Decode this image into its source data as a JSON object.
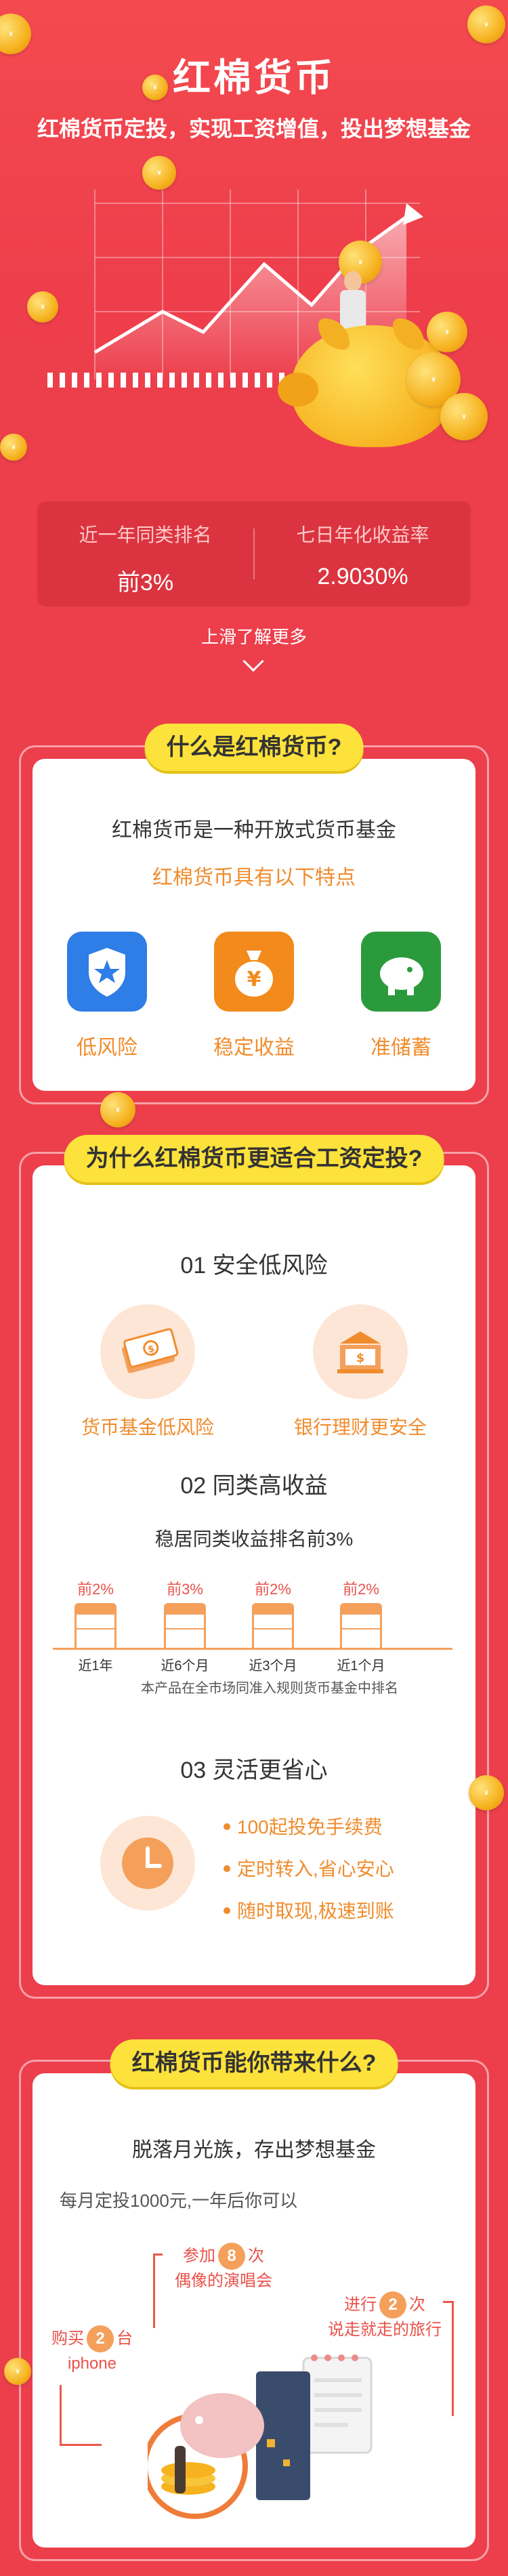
{
  "hero": {
    "title": "红棉货币",
    "subtitle": "红棉货币定投，实现工资增值，投出梦想基金"
  },
  "stats": [
    {
      "label": "近一年同类排名",
      "value": "前3%"
    },
    {
      "label": "七日年化收益率",
      "value": "2.9030%"
    }
  ],
  "more_label": "上滑了解更多",
  "section1": {
    "pill": "什么是红棉货币?",
    "line1": "红棉货币是一种开放式货币基金",
    "line2": "红棉货币具有以下特点",
    "features": [
      {
        "label": "低风险",
        "icon": "shield-star-icon",
        "color": "#2f7de6"
      },
      {
        "label": "稳定收益",
        "icon": "money-bag-icon",
        "color": "#f38a1c"
      },
      {
        "label": "准储蓄",
        "icon": "piggy-bank-icon",
        "color": "#2b9a3c"
      }
    ]
  },
  "section2": {
    "pill": "为什么红棉货币更适合工资定投?",
    "h1": "01 安全低风险",
    "h1_items": [
      "货币基金低风险",
      "银行理财更安全"
    ],
    "h2": "02 同类高收益",
    "h2_sub": "稳居同类收益排名前3%",
    "bars": [
      {
        "rank": "前2%",
        "period": "近1年"
      },
      {
        "rank": "前3%",
        "period": "近6个月"
      },
      {
        "rank": "前2%",
        "period": "近3个月"
      },
      {
        "rank": "前2%",
        "period": "近1个月"
      }
    ],
    "bars_note": "本产品在全市场同准入规则货币基金中排名",
    "h3": "03 灵活更省心",
    "h3_items": [
      "100起投免手续费",
      "定时转入,省心安心",
      "随时取现,极速到账"
    ]
  },
  "section3": {
    "pill": "红棉货币能你带来什么?",
    "line1": "脱落月光族，存出梦想基金",
    "line2": "每月定投1000元,一年后你可以",
    "tags": [
      {
        "pre": "参加",
        "num": "8",
        "post": "次",
        "line2": "偶像的演唱会"
      },
      {
        "pre": "进行",
        "num": "2",
        "post": "次",
        "line2": "说走就走的旅行"
      },
      {
        "pre": "购买",
        "num": "2",
        "post": "台",
        "line2": "iphone"
      }
    ]
  }
}
